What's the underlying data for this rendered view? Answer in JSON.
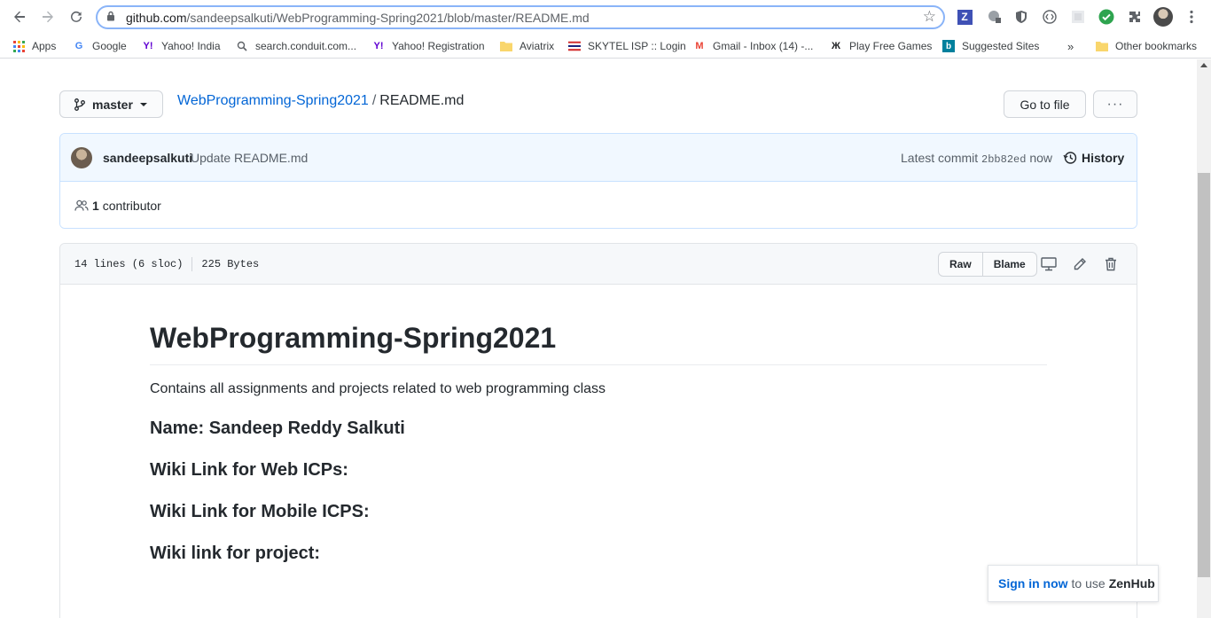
{
  "browser": {
    "url_host": "github.com",
    "url_path": "/sandeepsalkuti/WebProgramming-Spring2021/blob/master/README.md"
  },
  "bookmarks": [
    {
      "label": "Apps",
      "icon": "apps-grid-icon"
    },
    {
      "label": "Google",
      "icon": "google-icon"
    },
    {
      "label": "Yahoo! India",
      "icon": "yahoo-icon"
    },
    {
      "label": "search.conduit.com...",
      "icon": "search-icon"
    },
    {
      "label": "Yahoo! Registration",
      "icon": "yahoo-icon"
    },
    {
      "label": "Aviatrix",
      "icon": "folder-icon"
    },
    {
      "label": "SKYTEL ISP :: Login",
      "icon": "flag-icon"
    },
    {
      "label": "Gmail - Inbox (14) -...",
      "icon": "gmail-icon"
    },
    {
      "label": "Play Free Games",
      "icon": "games-icon"
    },
    {
      "label": "Suggested Sites",
      "icon": "bing-icon"
    },
    {
      "label": "»",
      "icon": "more-bookmarks-icon"
    },
    {
      "label": "Other bookmarks",
      "icon": "folder-icon"
    }
  ],
  "repo": {
    "branch": "master",
    "repo_name": "WebProgramming-Spring2021",
    "separator": "/",
    "file_name": "README.md",
    "go_to_file": "Go to file",
    "more": "···"
  },
  "commit": {
    "author": "sandeepsalkuti",
    "message": "Update README.md",
    "latest_label": "Latest commit",
    "sha": "2bb82ed",
    "time": "now",
    "history_label": "History",
    "contributors_count": "1",
    "contributors_label": "contributor"
  },
  "file": {
    "lines": "14 lines (6 sloc)",
    "size": "225 Bytes",
    "raw_label": "Raw",
    "blame_label": "Blame"
  },
  "readme": {
    "title": "WebProgramming-Spring2021",
    "description": "Contains all assignments and projects related to web programming class",
    "headings": [
      "Name: Sandeep Reddy Salkuti",
      "Wiki Link for Web ICPs:",
      "Wiki Link for Mobile ICPS:",
      "Wiki link for project:"
    ]
  },
  "zenhub": {
    "link": "Sign in now",
    "middle": "to use",
    "brand": "ZenHub"
  },
  "colors": {
    "link": "#0366d6",
    "commit_bg": "#f1f8ff",
    "zenhub_check": "#2ea44f"
  }
}
